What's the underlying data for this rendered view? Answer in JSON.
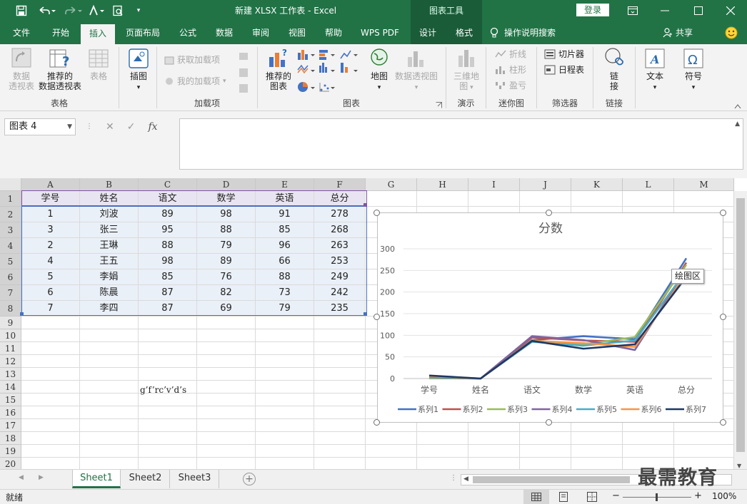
{
  "titlebar": {
    "title": "新建 XLSX 工作表  -  Excel",
    "context_title": "图表工具",
    "login": "登录",
    "icons": [
      "save-icon",
      "undo-icon",
      "redo-icon",
      "font-color-icon",
      "print-preview-icon",
      "customize-icon",
      "ribbon-display-icon",
      "minimize-icon",
      "restore-icon",
      "close-icon"
    ]
  },
  "tabs": [
    "文件",
    "开始",
    "插入",
    "页面布局",
    "公式",
    "数据",
    "审阅",
    "视图",
    "帮助",
    "WPS PDF",
    "设计",
    "格式"
  ],
  "active_tab": "插入",
  "tell_me": "操作说明搜索",
  "share": "共享",
  "ribbon": {
    "groups": {
      "tables": "表格",
      "illustrations": "",
      "addins": "加载项",
      "charts": "图表",
      "tours": "演示",
      "sparklines": "迷你图",
      "filters": "筛选器",
      "links": "链接"
    },
    "buttons": {
      "pivot": "数据\n透视表",
      "rec_pivot": "推荐的\n数据透视表",
      "table": "表格",
      "illustrations": "插图",
      "get_addins": "获取加载项",
      "my_addins": "我的加载项",
      "rec_charts": "推荐的\n图表",
      "maps": "地图",
      "pivot_chart": "数据透视图",
      "map3d": "三维地\n图",
      "line": "折线",
      "column": "柱形",
      "winloss": "盈亏",
      "slicer": "切片器",
      "timeline": "日程表",
      "link": "链\n接",
      "text": "文本",
      "symbol": "符号"
    }
  },
  "formula_bar": {
    "name_box": "图表 4",
    "formula": ""
  },
  "grid": {
    "columns": [
      "A",
      "B",
      "C",
      "D",
      "E",
      "F",
      "G",
      "H",
      "I",
      "J",
      "K",
      "L",
      "M"
    ],
    "rows": [
      "1",
      "2",
      "3",
      "4",
      "5",
      "6",
      "7",
      "8",
      "9",
      "10",
      "11",
      "12",
      "13",
      "14",
      "15",
      "16",
      "17",
      "18",
      "19",
      "20"
    ],
    "table": [
      [
        "学号",
        "姓名",
        "语文",
        "数学",
        "英语",
        "总分"
      ],
      [
        "1",
        "刘波",
        "89",
        "98",
        "91",
        "278"
      ],
      [
        "3",
        "张三",
        "95",
        "88",
        "85",
        "268"
      ],
      [
        "2",
        "王琳",
        "88",
        "79",
        "96",
        "263"
      ],
      [
        "4",
        "王五",
        "98",
        "89",
        "66",
        "253"
      ],
      [
        "5",
        "李娟",
        "85",
        "76",
        "88",
        "249"
      ],
      [
        "6",
        "陈晨",
        "87",
        "82",
        "73",
        "242"
      ],
      [
        "7",
        "李四",
        "87",
        "69",
        "79",
        "235"
      ]
    ],
    "stray_text": "g’f’rc’v’d’s"
  },
  "chart_data": {
    "type": "line",
    "title": "分数",
    "categories": [
      "学号",
      "姓名",
      "语文",
      "数学",
      "英语",
      "总分"
    ],
    "ylim": [
      0,
      300
    ],
    "yticks": [
      "0",
      "50",
      "100",
      "150",
      "200",
      "250",
      "300"
    ],
    "grid": true,
    "legend": "bottom",
    "series": [
      {
        "name": "系列1",
        "color": "#4472c4",
        "values": [
          1,
          0,
          89,
          98,
          91,
          278
        ]
      },
      {
        "name": "系列2",
        "color": "#c0504d",
        "values": [
          3,
          0,
          95,
          88,
          85,
          268
        ]
      },
      {
        "name": "系列3",
        "color": "#9bbb59",
        "values": [
          2,
          0,
          88,
          79,
          96,
          263
        ]
      },
      {
        "name": "系列4",
        "color": "#8064a2",
        "values": [
          4,
          0,
          98,
          89,
          66,
          253
        ]
      },
      {
        "name": "系列5",
        "color": "#4bacc6",
        "values": [
          5,
          0,
          85,
          76,
          88,
          249
        ]
      },
      {
        "name": "系列6",
        "color": "#f79646",
        "values": [
          6,
          0,
          87,
          82,
          73,
          242
        ]
      },
      {
        "name": "系列7",
        "color": "#1f3864",
        "values": [
          7,
          0,
          87,
          69,
          79,
          235
        ]
      }
    ]
  },
  "tooltip": "绘图区",
  "sheets": [
    "Sheet1",
    "Sheet2",
    "Sheet3"
  ],
  "active_sheet": "Sheet1",
  "watermark": "最需教育",
  "status": {
    "ready": "就绪",
    "zoom": "100%"
  },
  "colors": {
    "accent": "#217346",
    "ribbon_bg": "#f3f3f3"
  }
}
